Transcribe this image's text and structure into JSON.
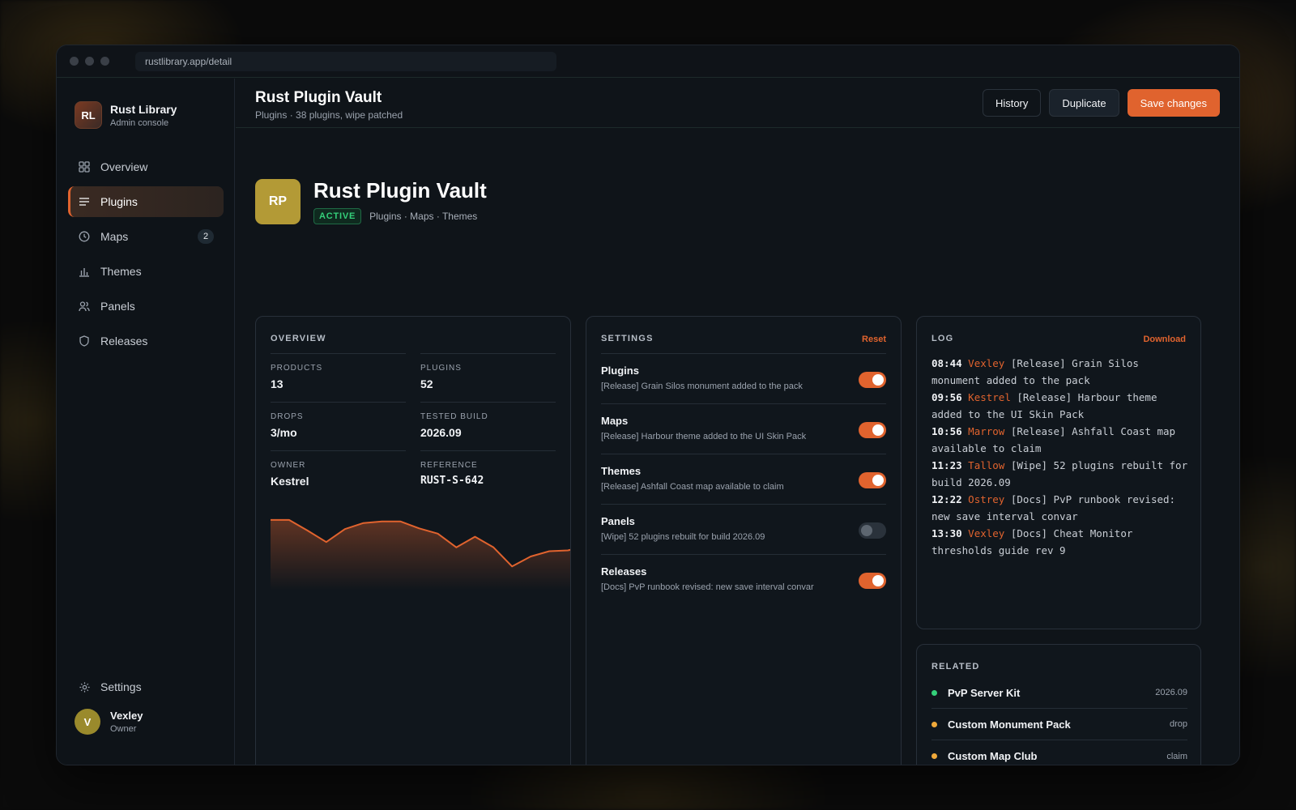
{
  "browser": {
    "url": "rustlibrary.app/detail"
  },
  "brand": {
    "initials": "RL",
    "name": "Rust Library",
    "subtitle": "Admin console"
  },
  "nav": [
    {
      "label": "Overview",
      "icon": "grid-icon",
      "active": false,
      "badge": ""
    },
    {
      "label": "Plugins",
      "icon": "list-icon",
      "active": true,
      "badge": ""
    },
    {
      "label": "Maps",
      "icon": "clock-icon",
      "active": false,
      "badge": "2"
    },
    {
      "label": "Themes",
      "icon": "bar-chart-icon",
      "active": false,
      "badge": ""
    },
    {
      "label": "Panels",
      "icon": "users-icon",
      "active": false,
      "badge": ""
    },
    {
      "label": "Releases",
      "icon": "shield-icon",
      "active": false,
      "badge": ""
    }
  ],
  "settings_nav": {
    "label": "Settings",
    "icon": "gear-icon"
  },
  "user": {
    "initial": "V",
    "name": "Vexley",
    "role": "Owner"
  },
  "header": {
    "title": "Rust Plugin Vault",
    "subtitle": "Plugins · 38 plugins, wipe patched",
    "history_label": "History",
    "duplicate_label": "Duplicate",
    "save_label": "Save changes"
  },
  "hero": {
    "initials": "RP",
    "title": "Rust Plugin Vault",
    "status": "ACTIVE",
    "tags": "Plugins · Maps · Themes"
  },
  "overview": {
    "title": "OVERVIEW",
    "stats": [
      {
        "label": "PRODUCTS",
        "value": "13"
      },
      {
        "label": "PLUGINS",
        "value": "52"
      },
      {
        "label": "DROPS",
        "value": "3/mo"
      },
      {
        "label": "TESTED BUILD",
        "value": "2026.09"
      },
      {
        "label": "OWNER",
        "value": "Kestrel"
      },
      {
        "label": "REFERENCE",
        "value": "RUST-S-642"
      }
    ],
    "sparkline": [
      82,
      82,
      68,
      53,
      70,
      78,
      80,
      80,
      71,
      64,
      46,
      60,
      46,
      21,
      34,
      41,
      42,
      48
    ]
  },
  "settings": {
    "title": "SETTINGS",
    "reset_label": "Reset",
    "rows": [
      {
        "name": "Plugins",
        "desc": "[Release] Grain Silos monument added to the pack",
        "on": true
      },
      {
        "name": "Maps",
        "desc": "[Release] Harbour theme added to the UI Skin Pack",
        "on": true
      },
      {
        "name": "Themes",
        "desc": "[Release] Ashfall Coast map available to claim",
        "on": true
      },
      {
        "name": "Panels",
        "desc": "[Wipe] 52 plugins rebuilt for build 2026.09",
        "on": false
      },
      {
        "name": "Releases",
        "desc": "[Docs] PvP runbook revised: new save interval convar",
        "on": true
      }
    ]
  },
  "log": {
    "title": "LOG",
    "download_label": "Download",
    "entries": [
      {
        "time": "08:44",
        "user": "Vexley",
        "text": "[Release] Grain Silos monument added to the pack"
      },
      {
        "time": "09:56",
        "user": "Kestrel",
        "text": "[Release] Harbour theme added to the UI Skin Pack"
      },
      {
        "time": "10:56",
        "user": "Marrow",
        "text": "[Release] Ashfall Coast map available to claim"
      },
      {
        "time": "11:23",
        "user": "Tallow",
        "text": "[Wipe] 52 plugins rebuilt for build 2026.09"
      },
      {
        "time": "12:22",
        "user": "Ostrey",
        "text": "[Docs] PvP runbook revised: new save interval convar"
      },
      {
        "time": "13:30",
        "user": "Vexley",
        "text": "[Docs] Cheat Monitor thresholds guide rev 9"
      }
    ]
  },
  "related": {
    "title": "RELATED",
    "items": [
      {
        "name": "PvP Server Kit",
        "meta": "2026.09",
        "color": "#34d07a"
      },
      {
        "name": "Custom Monument Pack",
        "meta": "drop",
        "color": "#f0a93a"
      },
      {
        "name": "Custom Map Club",
        "meta": "claim",
        "color": "#f0a93a"
      }
    ]
  },
  "colors": {
    "accent": "#e0632e",
    "success": "#34d07a",
    "warning": "#f0a93a"
  }
}
